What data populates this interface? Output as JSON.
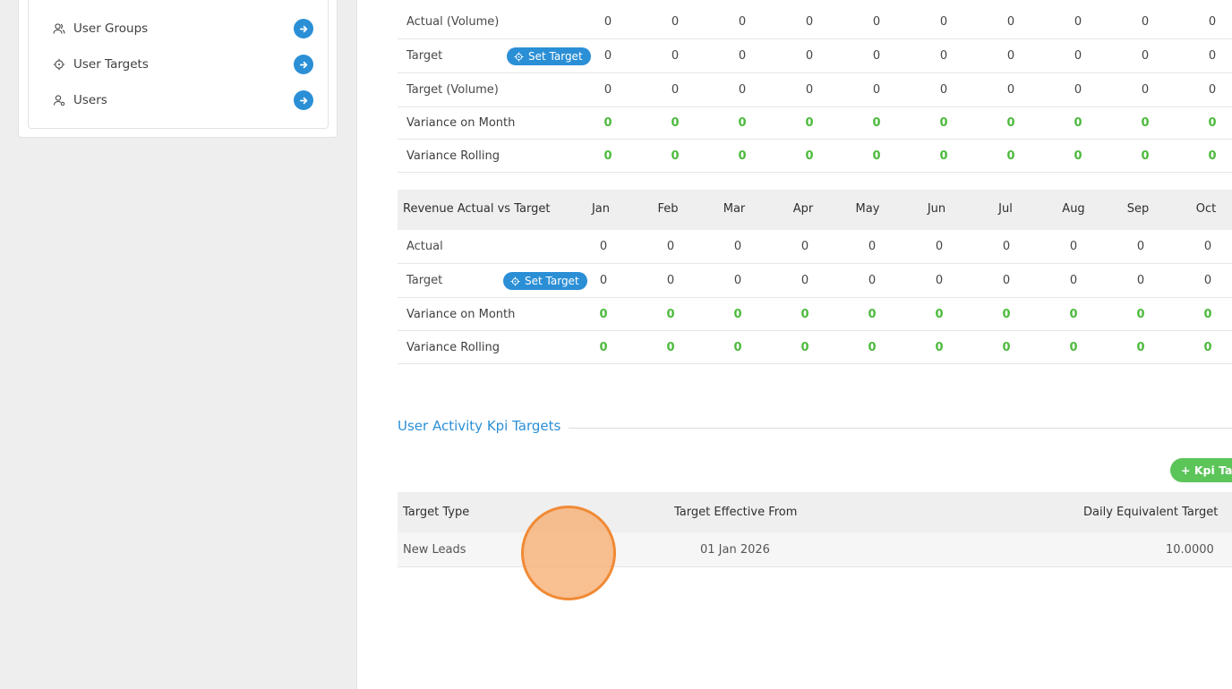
{
  "sidebar": {
    "items": [
      {
        "label": "User Groups",
        "icon": "users-icon"
      },
      {
        "label": "User Targets",
        "icon": "target-icon"
      },
      {
        "label": "Users",
        "icon": "user-icon"
      }
    ]
  },
  "volume_table": {
    "rows": [
      {
        "label": "Actual (Volume)",
        "values": [
          "0",
          "0",
          "0",
          "0",
          "0",
          "0",
          "0",
          "0",
          "0",
          "0"
        ],
        "green": false
      },
      {
        "label": "Target",
        "values": [
          "0",
          "0",
          "0",
          "0",
          "0",
          "0",
          "0",
          "0",
          "0",
          "0"
        ],
        "green": false,
        "button": "Set Target"
      },
      {
        "label": "Target (Volume)",
        "values": [
          "0",
          "0",
          "0",
          "0",
          "0",
          "0",
          "0",
          "0",
          "0",
          "0"
        ],
        "green": false
      },
      {
        "label": "Variance on Month",
        "values": [
          "0",
          "0",
          "0",
          "0",
          "0",
          "0",
          "0",
          "0",
          "0",
          "0"
        ],
        "green": true
      },
      {
        "label": "Variance Rolling",
        "values": [
          "0",
          "0",
          "0",
          "0",
          "0",
          "0",
          "0",
          "0",
          "0",
          "0"
        ],
        "green": true
      }
    ]
  },
  "revenue_table": {
    "title": "Revenue Actual vs Target",
    "months": [
      "Jan",
      "Feb",
      "Mar",
      "Apr",
      "May",
      "Jun",
      "Jul",
      "Aug",
      "Sep",
      "Oct"
    ],
    "rows": [
      {
        "label": "Actual",
        "values": [
          "0",
          "0",
          "0",
          "0",
          "0",
          "0",
          "0",
          "0",
          "0",
          "0"
        ],
        "green": false
      },
      {
        "label": "Target",
        "values": [
          "0",
          "0",
          "0",
          "0",
          "0",
          "0",
          "0",
          "0",
          "0",
          "0"
        ],
        "green": false,
        "button": "Set Target"
      },
      {
        "label": "Variance on Month",
        "values": [
          "0",
          "0",
          "0",
          "0",
          "0",
          "0",
          "0",
          "0",
          "0",
          "0"
        ],
        "green": true
      },
      {
        "label": "Variance Rolling",
        "values": [
          "0",
          "0",
          "0",
          "0",
          "0",
          "0",
          "0",
          "0",
          "0",
          "0"
        ],
        "green": true
      }
    ]
  },
  "kpi_section": {
    "title": "User Activity Kpi Targets",
    "add_button": "+ Kpi Tar",
    "columns": [
      "Target Type",
      "Target Effective From",
      "Daily Equivalent Target"
    ],
    "rows": [
      {
        "type": "New Leads",
        "from": "01 Jan 2026",
        "daily": "10.0000"
      }
    ]
  },
  "colors": {
    "accent": "#2b8fd6",
    "positive": "#4cba3c",
    "add_button": "#5cc55a",
    "cursor": "#f08a35"
  }
}
